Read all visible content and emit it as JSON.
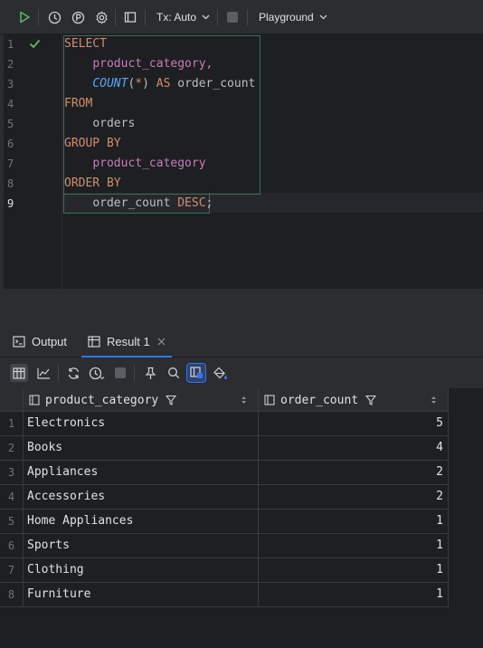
{
  "toolbar": {
    "tx_label": "Tx: Auto",
    "playground_label": "Playground"
  },
  "editor": {
    "line_numbers": [
      "1",
      "2",
      "3",
      "4",
      "5",
      "6",
      "7",
      "8",
      "9"
    ],
    "lines": {
      "l1": "SELECT",
      "l2": "product_category,",
      "l3_fn": "COUNT",
      "l3_paren_open": "(",
      "l3_star": "*",
      "l3_paren_close": ")",
      "l3_as": "AS",
      "l3_alias": "order_count",
      "l4": "FROM",
      "l5": "orders",
      "l6": "GROUP BY",
      "l7": "product_category",
      "l8": "ORDER BY",
      "l9_col": "order_count",
      "l9_desc": "DESC",
      "l9_semi": ";"
    }
  },
  "tabs": {
    "output_label": "Output",
    "result_label": "Result 1"
  },
  "grid": {
    "col1": "product_category",
    "col2": "order_count",
    "rows": [
      {
        "n": "1",
        "category": "Electronics",
        "count": "5"
      },
      {
        "n": "2",
        "category": "Books",
        "count": "4"
      },
      {
        "n": "3",
        "category": "Appliances",
        "count": "2"
      },
      {
        "n": "4",
        "category": "Accessories",
        "count": "2"
      },
      {
        "n": "5",
        "category": "Home Appliances",
        "count": "1"
      },
      {
        "n": "6",
        "category": "Sports",
        "count": "1"
      },
      {
        "n": "7",
        "category": "Clothing",
        "count": "1"
      },
      {
        "n": "8",
        "category": "Furniture",
        "count": "1"
      }
    ]
  },
  "colors": {
    "accent": "#3574f0",
    "run_green": "#5fb865",
    "keyword": "#cf8e6d",
    "identifier": "#c77dbb",
    "function": "#56a8f5"
  }
}
